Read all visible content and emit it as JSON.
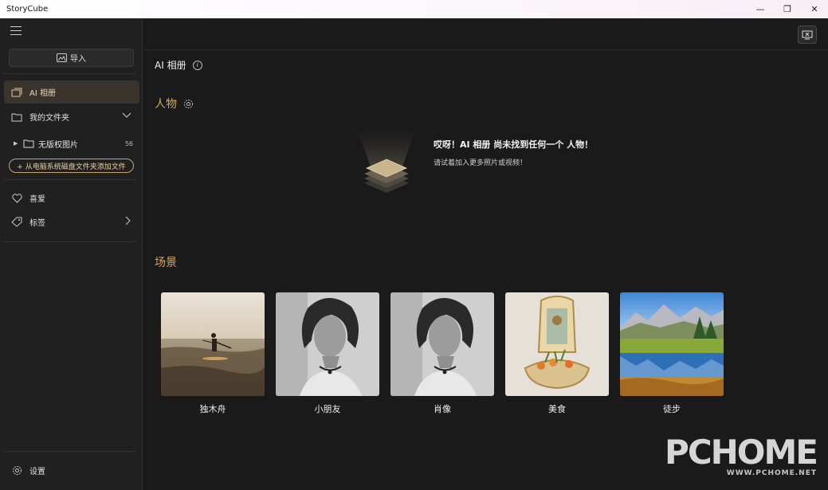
{
  "window": {
    "title": "StoryCube",
    "controls": [
      "minimize",
      "restore",
      "close"
    ]
  },
  "sidebar": {
    "import_label": "导入",
    "items": [
      {
        "label": "AI 相册",
        "icon": "ai-album-icon",
        "active": true
      },
      {
        "label": "我的文件夹",
        "icon": "folder-icon"
      }
    ],
    "folder": {
      "label": "无版权图片",
      "count": "56"
    },
    "add_folder_label": "+ 从电脑系统磁盘文件夹添加文件",
    "favorites_label": "喜爱",
    "tags_label": "标签",
    "settings_label": "设置"
  },
  "main": {
    "page_title": "AI 相册",
    "people": {
      "title": "人物",
      "empty_title": "哎呀！AI 相册 尚未找到任何一个 人物！",
      "empty_subtitle": "请试着加入更多照片或视频！"
    },
    "scenes": {
      "title": "场景",
      "items": [
        {
          "label": "独木舟",
          "kind": "canoe"
        },
        {
          "label": "小朋友",
          "kind": "portrait"
        },
        {
          "label": "肖像",
          "kind": "portrait"
        },
        {
          "label": "美食",
          "kind": "food"
        },
        {
          "label": "徒步",
          "kind": "landscape"
        }
      ]
    }
  },
  "watermark": {
    "logo": "PCHOME",
    "url": "WWW.PCHOME.NET"
  },
  "colors": {
    "accent": "#d4a862",
    "active_bg": "#3a342c",
    "background": "#1a1a1a"
  }
}
